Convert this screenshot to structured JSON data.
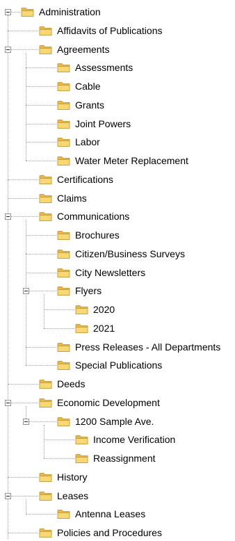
{
  "tree": {
    "nodes": [
      {
        "label": "Administration",
        "depth": 0,
        "expanded": true
      },
      {
        "label": "Affidavits of Publications",
        "depth": 1
      },
      {
        "label": "Agreements",
        "depth": 1,
        "expanded": true
      },
      {
        "label": "Assessments",
        "depth": 2
      },
      {
        "label": "Cable",
        "depth": 2
      },
      {
        "label": "Grants",
        "depth": 2
      },
      {
        "label": "Joint Powers",
        "depth": 2
      },
      {
        "label": "Labor",
        "depth": 2
      },
      {
        "label": "Water Meter Replacement",
        "depth": 2
      },
      {
        "label": "Certifications",
        "depth": 1
      },
      {
        "label": "Claims",
        "depth": 1
      },
      {
        "label": "Communications",
        "depth": 1,
        "expanded": true
      },
      {
        "label": "Brochures",
        "depth": 2
      },
      {
        "label": "Citizen/Business Surveys",
        "depth": 2
      },
      {
        "label": "City Newsletters",
        "depth": 2
      },
      {
        "label": "Flyers",
        "depth": 2,
        "expanded": true
      },
      {
        "label": "2020",
        "depth": 3
      },
      {
        "label": "2021",
        "depth": 3
      },
      {
        "label": "Press Releases - All Departments",
        "depth": 2
      },
      {
        "label": "Special Publications",
        "depth": 2
      },
      {
        "label": "Deeds",
        "depth": 1
      },
      {
        "label": "Economic Development",
        "depth": 1,
        "expanded": true
      },
      {
        "label": "1200 Sample Ave.",
        "depth": 2,
        "expanded": true
      },
      {
        "label": "Income Verification",
        "depth": 3
      },
      {
        "label": "Reassignment",
        "depth": 3
      },
      {
        "label": "History",
        "depth": 1
      },
      {
        "label": "Leases",
        "depth": 1,
        "expanded": true
      },
      {
        "label": "Antenna Leases",
        "depth": 2
      },
      {
        "label": "Policies and Procedures",
        "depth": 1
      }
    ]
  },
  "icons": {
    "folder": "folder-icon",
    "expander": "collapse-toggle-icon"
  },
  "colors": {
    "folder_fill": "#F8D775",
    "folder_back": "#E8B94A",
    "folder_edge": "#C9A040",
    "tree_lines": "#A0A0A0"
  }
}
